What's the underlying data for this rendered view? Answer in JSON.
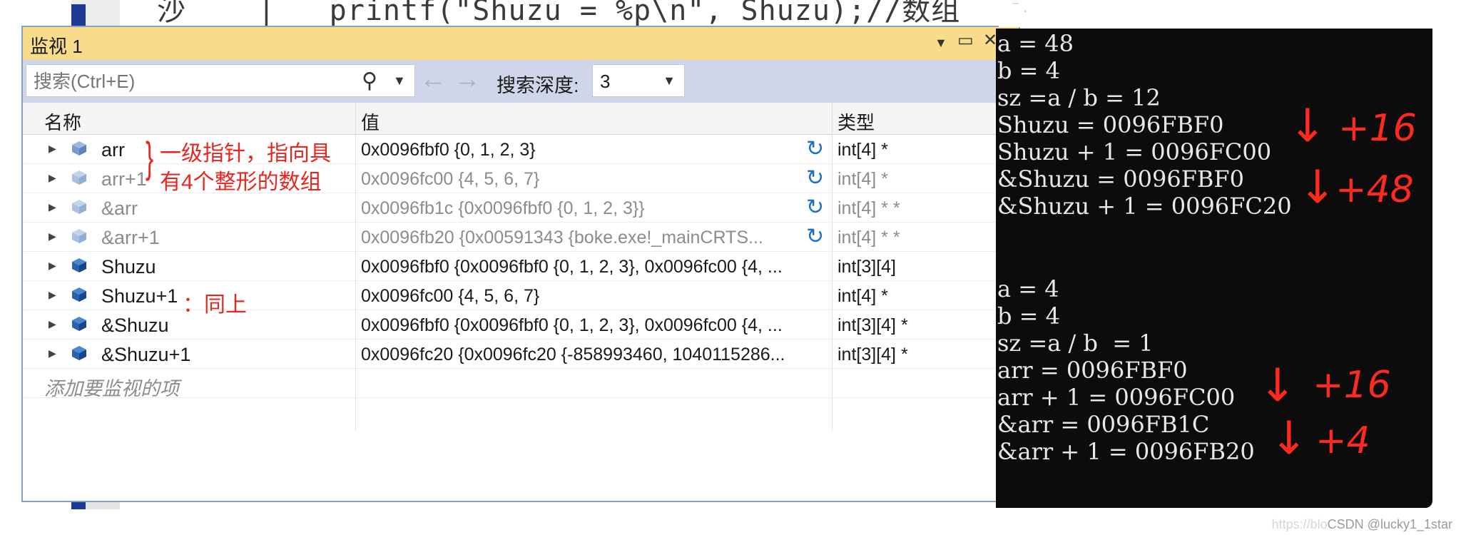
{
  "editor": {
    "code_snippet": "沙    |   printf(\"Shuzu = %p\\n\", Shuzu);//数组"
  },
  "watch_window": {
    "title": "监视 1",
    "search": {
      "placeholder": "搜索(Ctrl+E)"
    },
    "depth_label": "搜索深度:",
    "depth_value": "3",
    "columns": {
      "name": "名称",
      "value": "值",
      "type": "类型"
    },
    "rows": [
      {
        "name": "arr",
        "value": "0x0096fbf0 {0, 1, 2, 3}",
        "type": "int[4] *"
      },
      {
        "name": "arr+1",
        "value": "0x0096fc00 {4, 5, 6, 7}",
        "type": "int[4] *"
      },
      {
        "name": "&arr",
        "value": "0x0096fb1c {0x0096fbf0 {0, 1, 2, 3}}",
        "type": "int[4] * *"
      },
      {
        "name": "&arr+1",
        "value": "0x0096fb20 {0x00591343 {boke.exe!_mainCRTS...",
        "type": "int[4] * *"
      },
      {
        "name": "Shuzu",
        "value": "0x0096fbf0 {0x0096fbf0 {0, 1, 2, 3}, 0x0096fc00 {4, ...",
        "type": "int[3][4]"
      },
      {
        "name": "Shuzu+1",
        "value": "0x0096fc00 {4, 5, 6, 7}",
        "type": "int[4] *"
      },
      {
        "name": "&Shuzu",
        "value": "0x0096fbf0 {0x0096fbf0 {0, 1, 2, 3}, 0x0096fc00 {4, ...",
        "type": "int[3][4] *"
      },
      {
        "name": "&Shuzu+1",
        "value": "0x0096fc20 {0x0096fc20 {-858993460, 1040115286...",
        "type": "int[3][4] *"
      }
    ],
    "add_item": "添加要监视的项"
  },
  "annotations": {
    "arr_note_line1": "一级指针，指向具",
    "arr_note_line2": "有4个整形的数组",
    "shuzu1_note": "：同上"
  },
  "console": {
    "lines": [
      "a = 48",
      "b = 4",
      "sz =a / b = 12",
      "Shuzu = 0096FBF0",
      "Shuzu + 1 = 0096FC00",
      "&Shuzu = 0096FBF0",
      "&Shuzu + 1 = 0096FC20",
      "a = 4",
      "b = 4",
      "sz =a / b  = 1",
      "arr = 0096FBF0",
      "arr + 1 = 0096FC00",
      "&arr = 0096FB1C",
      "&arr + 1 = 0096FB20"
    ],
    "notes": [
      "+16",
      "+48",
      "+16",
      "+4"
    ]
  },
  "watermark": {
    "faint": "https://blo",
    "text": "CSDN @lucky1_1star"
  },
  "colors": {
    "title_bar": "#f8dc8c",
    "toolbar": "#cfd6ea",
    "annotation": "#e8261f",
    "console_bg": "#0c0c0c"
  }
}
